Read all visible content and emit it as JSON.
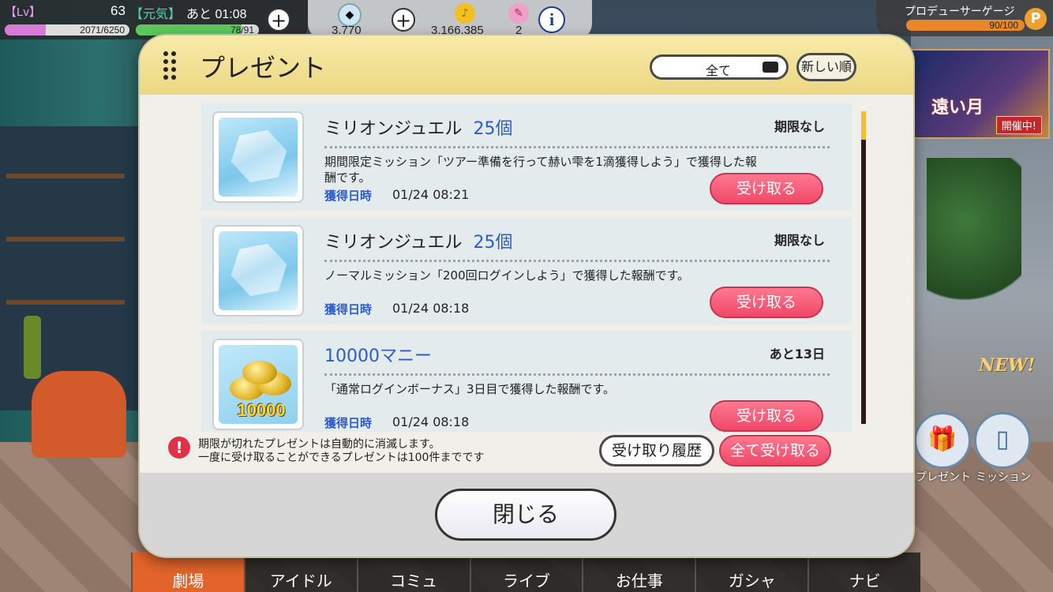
{
  "hud": {
    "lv_tag": "【Lv】",
    "level": "63",
    "genki": "【元気】",
    "timer": "あと 01:08",
    "exp": "2071/6250",
    "exp_fraction": 0.331,
    "stamina": "78/91",
    "stamina_fraction": 0.857,
    "jewels": "3,770",
    "money": "3,166,385",
    "tickets": "2",
    "producer_gauge_label": "プロデューサーゲージ",
    "producer_gauge_value": "90/100",
    "producer_gauge_fraction": 0.9,
    "p_icon": "P"
  },
  "event_banner": {
    "title": "遠い月",
    "badge": "開催中!"
  },
  "side": {
    "new_badge": "NEW!",
    "present_label": "プレゼント",
    "mission_label": "ミッション"
  },
  "nav": [
    "劇場",
    "アイドル",
    "コミュ",
    "ライブ",
    "お仕事",
    "ガシャ",
    "ナビ"
  ],
  "dialog": {
    "title": "プレゼント",
    "filter": "全て",
    "sort": "新しい順",
    "items": [
      {
        "name": "ミリオンジュエル",
        "qty": "25個",
        "limit": "期限なし",
        "desc": "期間限定ミッション「ツアー準備を行って赫い雫を1滴獲得しよう」で獲得した報酬です。",
        "date_label": "獲得日時",
        "date": "01/24 08:21",
        "button": "受け取る"
      },
      {
        "name": "ミリオンジュエル",
        "qty": "25個",
        "limit": "期限なし",
        "desc": "ノーマルミッション「200回ログインしよう」で獲得した報酬です。",
        "date_label": "獲得日時",
        "date": "01/24 08:18",
        "button": "受け取る"
      },
      {
        "name": "10000マニー",
        "qty": "",
        "limit": "あと13日",
        "desc": "「通常ログインボーナス」3日目で獲得した報酬です。",
        "date_label": "獲得日時",
        "date": "01/24 08:18",
        "button": "受け取る",
        "icon_text": "10000"
      }
    ],
    "notice_line1": "期限が切れたプレゼントは自動的に消滅します。",
    "notice_line2": "一度に受け取ることができるプレゼントは100件までです",
    "history_button": "受け取り履歴",
    "receive_all_button": "全て受け取る",
    "close_button": "閉じる"
  }
}
